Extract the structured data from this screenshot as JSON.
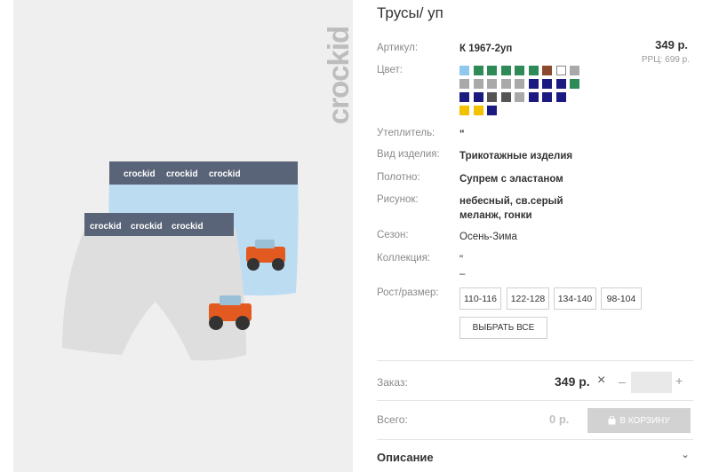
{
  "brand": "crockid",
  "product": {
    "title": "Трусы/ уп",
    "sku_label": "Артикул:",
    "sku": "К 1967-2уп",
    "price": "349 р.",
    "rrp": "РРЦ: 699 р.",
    "color_label": "Цвет:",
    "colors": [
      "#8ec8ee",
      "#2e8b57",
      "#2e8b57",
      "#2e8b57",
      "#2e8b57",
      "#2e8b57",
      "#8b4a2e",
      "#ffffff",
      "#a9a9a9",
      "#a9a9a9",
      "#a9a9a9",
      "#a9a9a9",
      "#a9a9a9",
      "#a9a9a9",
      "#1a1a80",
      "#1a1a80",
      "#1a1a80",
      "#2e8b57",
      "#1a1a80",
      "#1a1a80",
      "#555555",
      "#555555",
      "#a9a9a9",
      "#1a1a80",
      "#1a1a80",
      "#1a1a80",
      "#f2c200",
      "#f2c200",
      "#1a1a80"
    ],
    "attributes": [
      {
        "label": "Утеплитель:",
        "value": "\"",
        "bold": true
      },
      {
        "label": "Вид изделия:",
        "value": "Трикотажные изделия",
        "bold": true
      },
      {
        "label": "Полотно:",
        "value": "Супрем с эластаном",
        "bold": true
      },
      {
        "label": "Рисунок:",
        "value": "небесный, св.серый",
        "value2": "меланж, гонки",
        "bold": true
      },
      {
        "label": "Сезон:",
        "value": "Осень-Зима",
        "bold": false
      },
      {
        "label": "Коллекция:",
        "value": "\"",
        "value2": "–",
        "bold": false
      }
    ],
    "size_label": "Рост/размер:",
    "sizes": [
      "110-116",
      "122-128",
      "134-140",
      "98-104"
    ],
    "select_all": "ВЫБРАТЬ ВСЕ"
  },
  "order": {
    "label": "Заказ:",
    "price": "349 р.",
    "times": "×",
    "minus": "–",
    "plus": "+",
    "qty": ""
  },
  "total": {
    "label": "Всего:",
    "value": "0 р.",
    "cart_button": "В КОРЗИНУ"
  },
  "description": {
    "label": "Описание",
    "chevron": "⌄"
  },
  "image_text": {
    "band": "crockid"
  }
}
